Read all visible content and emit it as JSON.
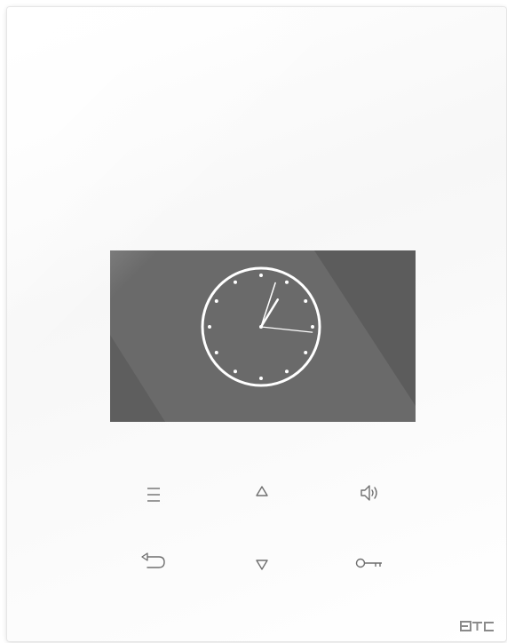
{
  "device": {
    "screen": {
      "background": "#6a6a6a",
      "content": "analog-clock",
      "clock": {
        "hour": 1,
        "minute": 3,
        "second": 16
      }
    },
    "buttons": [
      {
        "name": "menu-button",
        "icon": "menu-icon"
      },
      {
        "name": "up-button",
        "icon": "triangle-up-icon"
      },
      {
        "name": "volume-button",
        "icon": "speaker-icon"
      },
      {
        "name": "back-button",
        "icon": "back-arrow-icon"
      },
      {
        "name": "down-button",
        "icon": "triangle-down-icon"
      },
      {
        "name": "door-open-button",
        "icon": "key-icon"
      }
    ],
    "brand": {
      "logo_text": "ETC",
      "color": "#8a8a8a"
    },
    "icon_color": "#6f6f6f"
  }
}
